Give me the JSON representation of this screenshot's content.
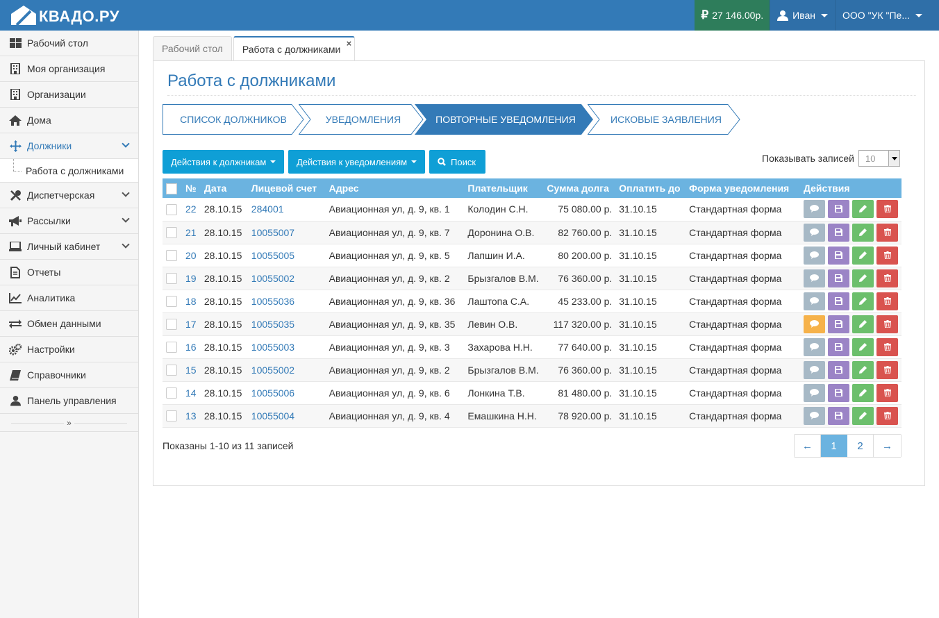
{
  "header": {
    "logo_text": "КВАДО.РУ",
    "balance": "27 146.00р.",
    "user": "Иван",
    "org": "ООО \"УК \"Пе..."
  },
  "sidebar": {
    "items": [
      {
        "label": "Рабочий стол"
      },
      {
        "label": "Моя организация"
      },
      {
        "label": "Организации"
      },
      {
        "label": "Дома"
      },
      {
        "label": "Должники"
      },
      {
        "label": "Работа с должниками"
      },
      {
        "label": "Диспетчерская"
      },
      {
        "label": "Рассылки"
      },
      {
        "label": "Личный кабинет"
      },
      {
        "label": "Отчеты"
      },
      {
        "label": "Аналитика"
      },
      {
        "label": "Обмен данными"
      },
      {
        "label": "Настройки"
      },
      {
        "label": "Справочники"
      },
      {
        "label": "Панель управления"
      }
    ],
    "collapse": "»"
  },
  "tabs": [
    {
      "label": "Рабочий стол"
    },
    {
      "label": "Работа с должниками",
      "close": "×"
    }
  ],
  "page": {
    "title": "Работа с должниками"
  },
  "steps": [
    {
      "label": "Список должников"
    },
    {
      "label": "Уведомления"
    },
    {
      "label": "Повторные уведомления"
    },
    {
      "label": "Исковые заявления"
    }
  ],
  "toolbar": {
    "debtors_actions": "Действия к должникам",
    "notif_actions": "Действия к уведомлениям",
    "search": "Поиск",
    "per_page_label": "Показывать записей",
    "per_page_value": "10"
  },
  "table": {
    "columns": [
      "№",
      "Дата",
      "Лицевой счет",
      "Адрес",
      "Плательщик",
      "Сумма долга",
      "Оплатить до",
      "Форма уведомления",
      "Действия"
    ],
    "rows": [
      {
        "n": "22",
        "date": "28.10.15",
        "account": "284001",
        "address": "Авиационная ул, д. 9, кв. 1",
        "payer": "Колодин С.Н.",
        "amount": "75 080.00 р.",
        "due": "31.10.15",
        "form": "Стандартная форма",
        "warn": false
      },
      {
        "n": "21",
        "date": "28.10.15",
        "account": "10055007",
        "address": "Авиационная ул, д. 9, кв. 7",
        "payer": "Доронина О.В.",
        "amount": "82 760.00 р.",
        "due": "31.10.15",
        "form": "Стандартная форма",
        "warn": false
      },
      {
        "n": "20",
        "date": "28.10.15",
        "account": "10055005",
        "address": "Авиационная ул, д. 9, кв. 5",
        "payer": "Лапшин И.А.",
        "amount": "80 200.00 р.",
        "due": "31.10.15",
        "form": "Стандартная форма",
        "warn": false
      },
      {
        "n": "19",
        "date": "28.10.15",
        "account": "10055002",
        "address": "Авиационная ул, д. 9, кв. 2",
        "payer": "Брызгалов В.М.",
        "amount": "76 360.00 р.",
        "due": "31.10.15",
        "form": "Стандартная форма",
        "warn": false
      },
      {
        "n": "18",
        "date": "28.10.15",
        "account": "10055036",
        "address": "Авиационная ул, д. 9, кв. 36",
        "payer": "Лаштопа С.А.",
        "amount": "45 233.00 р.",
        "due": "31.10.15",
        "form": "Стандартная форма",
        "warn": false
      },
      {
        "n": "17",
        "date": "28.10.15",
        "account": "10055035",
        "address": "Авиационная ул, д. 9, кв. 35",
        "payer": "Левин О.В.",
        "amount": "117 320.00 р.",
        "due": "31.10.15",
        "form": "Стандартная форма",
        "warn": true
      },
      {
        "n": "16",
        "date": "28.10.15",
        "account": "10055003",
        "address": "Авиационная ул, д. 9, кв. 3",
        "payer": "Захарова Н.Н.",
        "amount": "77 640.00 р.",
        "due": "31.10.15",
        "form": "Стандартная форма",
        "warn": false
      },
      {
        "n": "15",
        "date": "28.10.15",
        "account": "10055002",
        "address": "Авиационная ул, д. 9, кв. 2",
        "payer": "Брызгалов В.М.",
        "amount": "76 360.00 р.",
        "due": "31.10.15",
        "form": "Стандартная форма",
        "warn": false
      },
      {
        "n": "14",
        "date": "28.10.15",
        "account": "10055006",
        "address": "Авиационная ул, д. 9, кв. 6",
        "payer": "Лонкина Т.В.",
        "amount": "81 480.00 р.",
        "due": "31.10.15",
        "form": "Стандартная форма",
        "warn": false
      },
      {
        "n": "13",
        "date": "28.10.15",
        "account": "10055004",
        "address": "Авиационная ул, д. 9, кв. 4",
        "payer": "Емашкина Н.Н.",
        "amount": "78 920.00 р.",
        "due": "31.10.15",
        "form": "Стандартная форма",
        "warn": false
      }
    ]
  },
  "footer": {
    "summary": "Показаны 1-10 из 11 записей",
    "pager": [
      "←",
      "1",
      "2",
      "→"
    ]
  },
  "colors": {
    "primary": "#337ab7",
    "header_row": "#6bb3e0",
    "action_button": "#0f9fd6",
    "balance_bg": "#2e7d5b",
    "msg_btn": "#a7b9c6",
    "msg_btn_warn": "#f6b24a",
    "save_btn": "#9b84c6",
    "edit_btn": "#6cbf6c",
    "delete_btn": "#d9534f"
  },
  "icons": {
    "row_actions": [
      "comment-icon",
      "floppy-disk-icon",
      "pencil-icon",
      "trash-icon"
    ]
  }
}
